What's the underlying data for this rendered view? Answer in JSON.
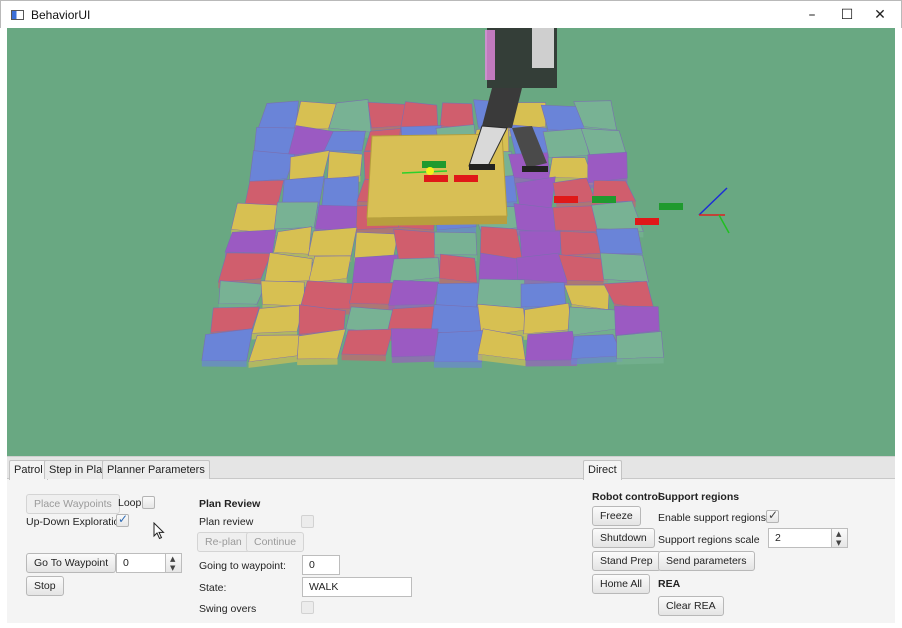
{
  "window": {
    "title": "BehaviorUI",
    "icon": "app-window-icon"
  },
  "window_controls": {
    "minimize": "–",
    "maximize": "☐",
    "close": "✕"
  },
  "viewport": {
    "background_color": "#69a882",
    "tile_colors": [
      "#d7c052",
      "#d05e6d",
      "#6a84d8",
      "#9b5ac2",
      "#78b294"
    ]
  },
  "left_panel": {
    "tabs": [
      "Patrol",
      "Step in Place",
      "Planner Parameters"
    ],
    "patrol": {
      "place_waypoints_label": "Place Waypoints",
      "loop_label": "Loop:",
      "loop_checked": false,
      "up_down_label": "Up-Down Exploration",
      "up_down_checked": true,
      "go_to_waypoint_label": "Go To Waypoint",
      "waypoint_value": "0",
      "stop_label": "Stop"
    },
    "plan_review": {
      "header": "Plan Review",
      "plan_review_label": "Plan review",
      "plan_review_checked": false,
      "replan_label": "Re-plan",
      "continue_label": "Continue",
      "going_to_waypoint_label": "Going to waypoint:",
      "going_to_waypoint_value": "0",
      "state_label": "State:",
      "state_value": "WALK",
      "swing_overs_label": "Swing overs",
      "swing_overs_checked": false
    }
  },
  "right_panel": {
    "tabs": [
      "Direct"
    ],
    "robot_control": {
      "header": "Robot control",
      "freeze_label": "Freeze",
      "shutdown_label": "Shutdown",
      "stand_prep_label": "Stand Prep",
      "home_all_label": "Home All"
    },
    "support_regions": {
      "header": "Support regions",
      "enable_label": "Enable support regions",
      "enable_checked": true,
      "scale_label": "Support regions scale",
      "scale_value": "2",
      "send_parameters_label": "Send parameters"
    },
    "rea": {
      "header": "REA",
      "clear_label": "Clear REA"
    }
  }
}
